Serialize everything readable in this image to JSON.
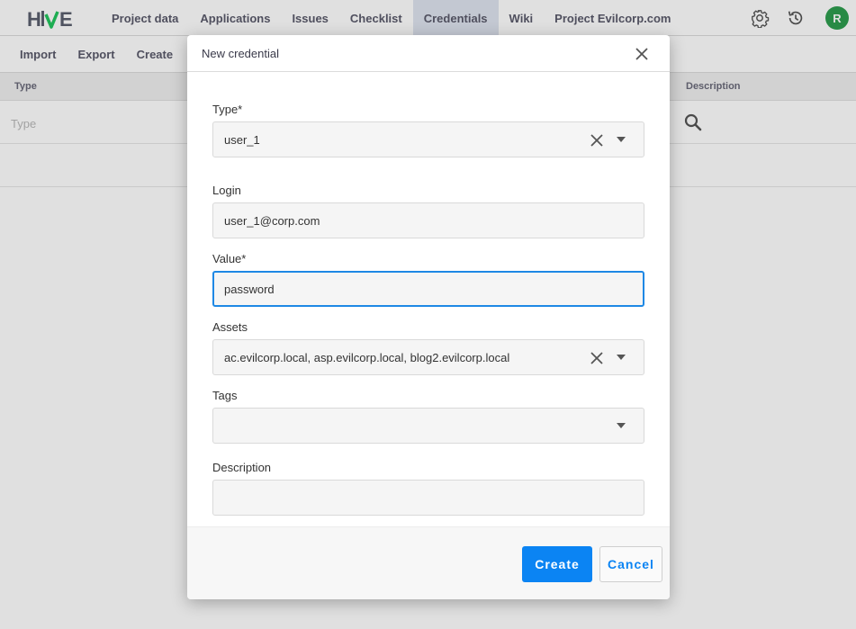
{
  "brand": {
    "logo_text": "HIVE",
    "accent": "#2e9e4f",
    "primary": "#0b84f3"
  },
  "nav": {
    "tabs": [
      {
        "label": "Project data"
      },
      {
        "label": "Applications"
      },
      {
        "label": "Issues"
      },
      {
        "label": "Checklist"
      },
      {
        "label": "Credentials",
        "active": true
      },
      {
        "label": "Wiki"
      },
      {
        "label": "Project Evilcorp.com"
      }
    ],
    "icons": [
      "gear-icon",
      "history-icon"
    ],
    "avatar_initial": "R"
  },
  "toolbar": {
    "import_label": "Import",
    "export_label": "Export",
    "create_label": "Create"
  },
  "table": {
    "columns": {
      "type": "Type",
      "description": "Description"
    },
    "filter_type_placeholder": "Type"
  },
  "modal": {
    "title": "New credential",
    "fields": {
      "type": {
        "label": "Type*",
        "value": "user_1"
      },
      "login": {
        "label": "Login",
        "value": "user_1@corp.com"
      },
      "value": {
        "label": "Value*",
        "value": "password"
      },
      "assets": {
        "label": "Assets",
        "value": "ac.evilcorp.local, asp.evilcorp.local, blog2.evilcorp.local"
      },
      "tags": {
        "label": "Tags",
        "value": ""
      },
      "description": {
        "label": "Description",
        "value": ""
      }
    },
    "create_label": "Create",
    "cancel_label": "Cancel"
  }
}
